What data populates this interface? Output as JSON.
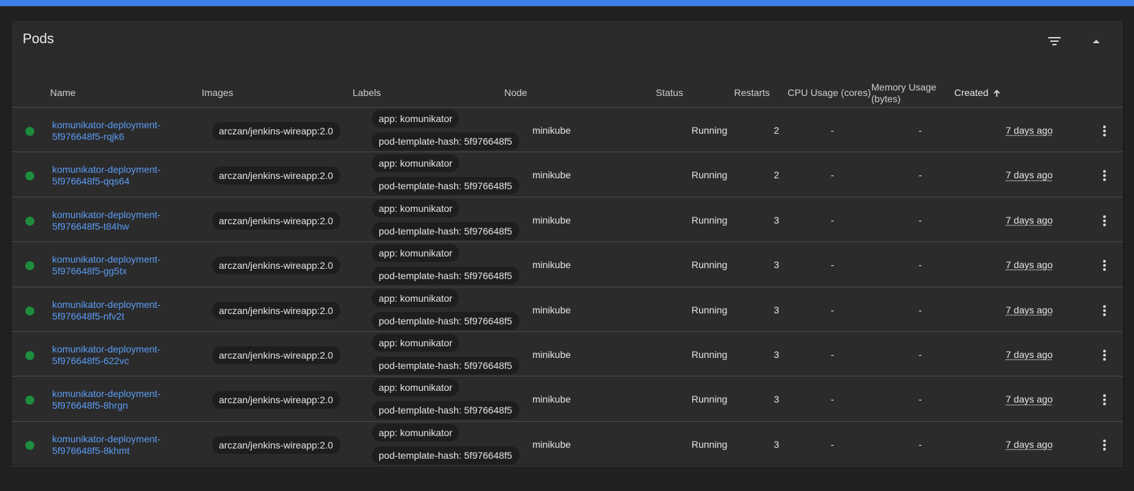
{
  "card": {
    "title": "Pods",
    "filter_icon": "filter-list-icon",
    "collapse_icon": "arrow-drop-up-icon"
  },
  "columns": {
    "name": "Name",
    "images": "Images",
    "labels": "Labels",
    "node": "Node",
    "status": "Status",
    "restarts": "Restarts",
    "cpu": "CPU Usage (cores)",
    "memory_line1": "Memory Usage",
    "memory_line2": "(bytes)",
    "created": "Created",
    "sort_icon": "arrow-upward-icon"
  },
  "colors": {
    "accent": "#3d7fe8",
    "status_running": "#1e8e3e",
    "link": "#5b9cf5"
  },
  "rows": [
    {
      "name_line1": "komunikator-deployment-",
      "name_line2": "5f976648f5-rqjk6",
      "image": "arczan/jenkins-wireapp:2.0",
      "label1": "app: komunikator",
      "label2": "pod-template-hash: 5f976648f5",
      "node": "minikube",
      "status": "Running",
      "restarts": "2",
      "cpu": "-",
      "memory": "-",
      "created": "7 days ago"
    },
    {
      "name_line1": "komunikator-deployment-",
      "name_line2": "5f976648f5-qqs64",
      "image": "arczan/jenkins-wireapp:2.0",
      "label1": "app: komunikator",
      "label2": "pod-template-hash: 5f976648f5",
      "node": "minikube",
      "status": "Running",
      "restarts": "2",
      "cpu": "-",
      "memory": "-",
      "created": "7 days ago"
    },
    {
      "name_line1": "komunikator-deployment-",
      "name_line2": "5f976648f5-t84hw",
      "image": "arczan/jenkins-wireapp:2.0",
      "label1": "app: komunikator",
      "label2": "pod-template-hash: 5f976648f5",
      "node": "minikube",
      "status": "Running",
      "restarts": "3",
      "cpu": "-",
      "memory": "-",
      "created": "7 days ago"
    },
    {
      "name_line1": "komunikator-deployment-",
      "name_line2": "5f976648f5-gg5tx",
      "image": "arczan/jenkins-wireapp:2.0",
      "label1": "app: komunikator",
      "label2": "pod-template-hash: 5f976648f5",
      "node": "minikube",
      "status": "Running",
      "restarts": "3",
      "cpu": "-",
      "memory": "-",
      "created": "7 days ago"
    },
    {
      "name_line1": "komunikator-deployment-",
      "name_line2": "5f976648f5-nfv2t",
      "image": "arczan/jenkins-wireapp:2.0",
      "label1": "app: komunikator",
      "label2": "pod-template-hash: 5f976648f5",
      "node": "minikube",
      "status": "Running",
      "restarts": "3",
      "cpu": "-",
      "memory": "-",
      "created": "7 days ago"
    },
    {
      "name_line1": "komunikator-deployment-",
      "name_line2": "5f976648f5-622vc",
      "image": "arczan/jenkins-wireapp:2.0",
      "label1": "app: komunikator",
      "label2": "pod-template-hash: 5f976648f5",
      "node": "minikube",
      "status": "Running",
      "restarts": "3",
      "cpu": "-",
      "memory": "-",
      "created": "7 days ago"
    },
    {
      "name_line1": "komunikator-deployment-",
      "name_line2": "5f976648f5-8hrgn",
      "image": "arczan/jenkins-wireapp:2.0",
      "label1": "app: komunikator",
      "label2": "pod-template-hash: 5f976648f5",
      "node": "minikube",
      "status": "Running",
      "restarts": "3",
      "cpu": "-",
      "memory": "-",
      "created": "7 days ago"
    },
    {
      "name_line1": "komunikator-deployment-",
      "name_line2": "5f976648f5-8khmt",
      "image": "arczan/jenkins-wireapp:2.0",
      "label1": "app: komunikator",
      "label2": "pod-template-hash: 5f976648f5",
      "node": "minikube",
      "status": "Running",
      "restarts": "3",
      "cpu": "-",
      "memory": "-",
      "created": "7 days ago"
    }
  ]
}
